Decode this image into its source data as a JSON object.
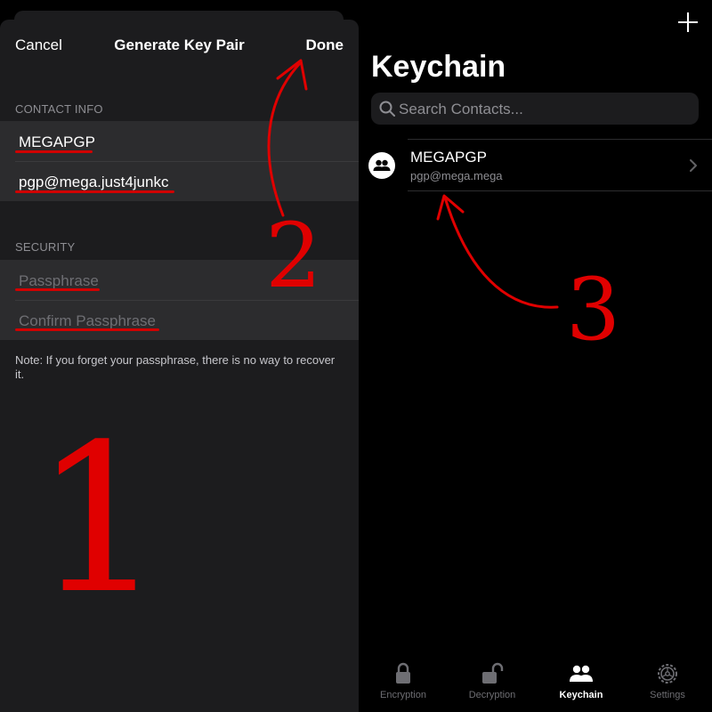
{
  "left": {
    "nav": {
      "cancel": "Cancel",
      "title": "Generate Key Pair",
      "done": "Done"
    },
    "contact_info_header": "CONTACT INFO",
    "name_value": "MEGAPGP",
    "email_value": "pgp@mega.just4junkc",
    "security_header": "SECURITY",
    "passphrase_placeholder": "Passphrase",
    "confirm_placeholder": "Confirm Passphrase",
    "note": "Note: If you forget your passphrase, there is no way to recover it."
  },
  "right": {
    "title": "Keychain",
    "search_placeholder": "Search Contacts...",
    "contacts": [
      {
        "name": "MEGAPGP",
        "email": "pgp@mega.mega"
      }
    ],
    "tabs": [
      {
        "label": "Encryption",
        "icon": "lock-icon",
        "active": false
      },
      {
        "label": "Decryption",
        "icon": "unlock-icon",
        "active": false
      },
      {
        "label": "Keychain",
        "icon": "people-icon",
        "active": true
      },
      {
        "label": "Settings",
        "icon": "gear-icon",
        "active": false
      }
    ]
  },
  "annotations": {
    "step1": "1",
    "step2": "2",
    "step3": "3"
  },
  "colors": {
    "annotation": "#e00000",
    "sheet": "#1c1c1e",
    "cell": "#2c2c2e"
  }
}
